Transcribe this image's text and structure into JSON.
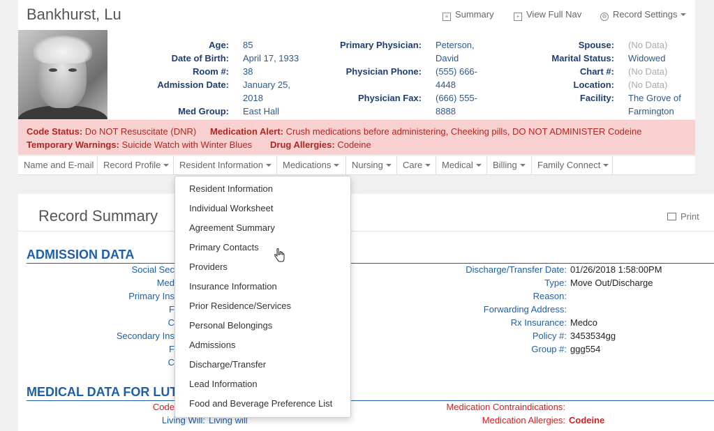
{
  "header": {
    "name": "Bankhurst, Lu",
    "links": {
      "summary": "Summary",
      "full_nav": "View Full Nav",
      "settings": "Record Settings"
    }
  },
  "info": {
    "col1": [
      {
        "label": "Age:",
        "value": "85"
      },
      {
        "label": "Date of Birth:",
        "value": "April 17, 1933"
      },
      {
        "label": "Room #:",
        "value": "38"
      },
      {
        "label": "Admission Date:",
        "value_line1": "January 25,",
        "value_line2": "2018"
      },
      {
        "label": "Med Group:",
        "value": "East Hall"
      }
    ],
    "col2": [
      {
        "label": "Primary Physician:",
        "value_line1": "Peterson,",
        "value_line2": "David"
      },
      {
        "label": "Physician Phone:",
        "value_line1": "(555) 666-",
        "value_line2": "4448"
      },
      {
        "label": "Physician Fax:",
        "value_line1": "(666) 555-",
        "value_line2": "8888"
      }
    ],
    "col3": [
      {
        "label": "Spouse:",
        "value": "(No Data)"
      },
      {
        "label": "Marital Status:",
        "value": "Widowed"
      },
      {
        "label": "Chart #:",
        "value": "(No Data)"
      },
      {
        "label": "Location:",
        "value": "(No Data)"
      },
      {
        "label": "Facility:",
        "value_line1": "The Grove of",
        "value_line2": "Farmington"
      }
    ]
  },
  "alerts": {
    "code_status_label": "Code Status:",
    "code_status_value": "Do NOT Resuscitate (DNR)",
    "med_alert_label": "Medication Alert:",
    "med_alert_value": "Crush medications before administering, Cheeking pills, DO NOT ADMINISTER Codeine",
    "temp_label": "Temporary Warnings:",
    "temp_value": "Suicide Watch with Winter Blues",
    "allergy_label": "Drug Allergies:",
    "allergy_value": "Codeine"
  },
  "tabs": [
    "Name and E-mail",
    "Record Profile",
    "Resident Information",
    "Medications",
    "Nursing",
    "Care",
    "Medical",
    "Billing",
    "Family Connect"
  ],
  "summary": {
    "title": "Record Summary",
    "print": "Print",
    "admission": {
      "title": "ADMISSION DATA",
      "left_labels": [
        "Social Sec",
        "Med",
        "Primary Ins",
        "F",
        "C",
        "Secondary Ins",
        "F",
        "C"
      ],
      "right": [
        {
          "label": "Discharge/Transfer Date:",
          "value": "01/26/2018 1:58:00PM"
        },
        {
          "label": "Type:",
          "value": "Move Out/Discharge"
        },
        {
          "label": "Reason:",
          "value": ""
        },
        {
          "label": "Forwarding Address:",
          "value": ""
        },
        {
          "label": "Rx Insurance:",
          "value": "Medco"
        },
        {
          "label": "Policy #:",
          "value": "3453534gg"
        },
        {
          "label": "Group #:",
          "value": "ggg554"
        }
      ]
    },
    "medical": {
      "title": "MEDICAL DATA FOR LUTE",
      "code_label": "Code",
      "living_will_label": "Living Will:",
      "living_will_value": "Living will",
      "contra_label": "Medication Contraindications:",
      "allergies_label": "Medication Allergies:",
      "allergies_value": "Codeine"
    }
  },
  "dropdown": [
    "Resident Information",
    "Individual Worksheet",
    "Agreement Summary",
    "Primary Contacts",
    "Providers",
    "Insurance Information",
    "Prior Residence/Services",
    "Personal Belongings",
    "Admissions",
    "Discharge/Transfer",
    "Lead Information",
    "Food and Beverage Preference List"
  ]
}
